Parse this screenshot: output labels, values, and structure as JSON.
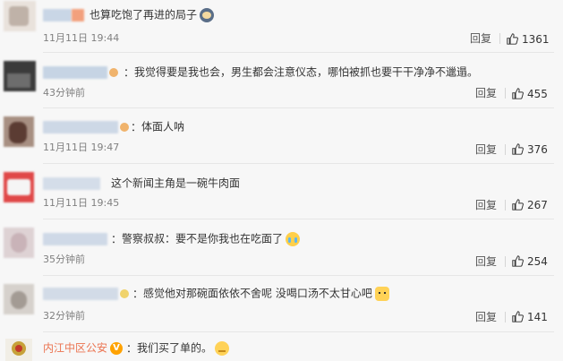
{
  "comments": [
    {
      "text": "也算吃饱了再进的局子",
      "emoji": "crying-face-emoji",
      "meta": "11月11日 19:44",
      "reply": "回复",
      "likes": "1361"
    },
    {
      "text": "我觉得要是我也会，男生都会注意仪态，哪怕被抓也要干干净净不邋遢。",
      "meta": "43分钟前",
      "reply": "回复",
      "likes": "455"
    },
    {
      "text": "体面人呐",
      "meta": "11月11日 19:47",
      "reply": "回复",
      "likes": "376"
    },
    {
      "text": "这个新闻主角是一碗牛肉面",
      "meta": "11月11日 19:45",
      "reply": "回复",
      "likes": "267"
    },
    {
      "text": "警察叔叔：要不是你我也在吃面了",
      "emoji": "crying-face-emoji",
      "meta": "35分钟前",
      "reply": "回复",
      "likes": "254"
    },
    {
      "text": "感觉他对那碗面依依不舍呢 没喝口汤不太甘心吧",
      "emoji": "cat-face-emoji",
      "meta": "32分钟前",
      "reply": "回复",
      "likes": "141"
    },
    {
      "author": "内江中区公安",
      "verified": "V",
      "text": "我们买了单的。",
      "emoji": "smirk-face-emoji"
    }
  ],
  "colors": {
    "background": "#f7f7f7",
    "author_link": "#eb7350",
    "meta_text": "#808080",
    "verified_badge": "#ffa200"
  }
}
